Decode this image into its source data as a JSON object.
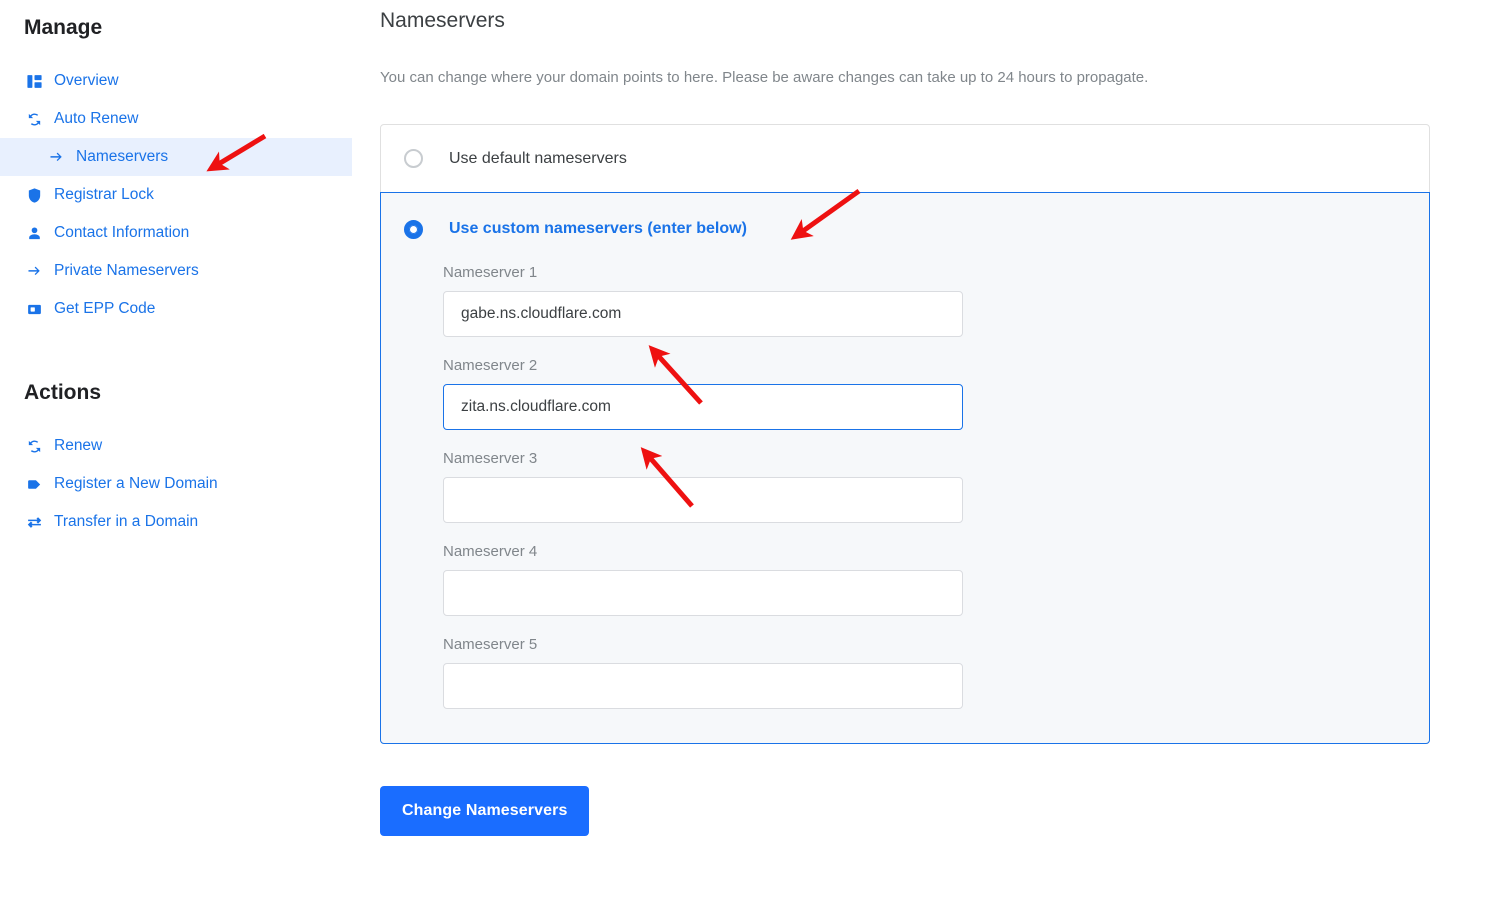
{
  "sidebar": {
    "manage_heading": "Manage",
    "manage_items": [
      {
        "label": "Overview",
        "icon": "dashboard-icon"
      },
      {
        "label": "Auto Renew",
        "icon": "refresh-icon"
      },
      {
        "label": "Nameservers",
        "icon": "arrow-forward-icon",
        "active": true
      },
      {
        "label": "Registrar Lock",
        "icon": "shield-icon"
      },
      {
        "label": "Contact Information",
        "icon": "person-icon"
      },
      {
        "label": "Private Nameservers",
        "icon": "arrow-forward-icon"
      },
      {
        "label": "Get EPP Code",
        "icon": "card-icon"
      }
    ],
    "actions_heading": "Actions",
    "action_items": [
      {
        "label": "Renew",
        "icon": "refresh-icon"
      },
      {
        "label": "Register a New Domain",
        "icon": "tag-icon"
      },
      {
        "label": "Transfer in a Domain",
        "icon": "swap-icon"
      }
    ]
  },
  "main": {
    "title": "Nameservers",
    "description": "You can change where your domain points to here. Please be aware changes can take up to 24 hours to propagate.",
    "options": {
      "default_label": "Use default nameservers",
      "custom_label": "Use custom nameservers (enter below)",
      "selected": "custom"
    },
    "nameserver_fields": [
      {
        "label": "Nameserver 1",
        "value": "gabe.ns.cloudflare.com",
        "placeholder": "",
        "focused": false
      },
      {
        "label": "Nameserver 2",
        "value": "zita.ns.cloudflare.com",
        "placeholder": "",
        "focused": true
      },
      {
        "label": "Nameserver 3",
        "value": "",
        "placeholder": "",
        "focused": false
      },
      {
        "label": "Nameserver 4",
        "value": "",
        "placeholder": "",
        "focused": false
      },
      {
        "label": "Nameserver 5",
        "value": "",
        "placeholder": "",
        "focused": false
      }
    ],
    "submit_label": "Change Nameservers"
  },
  "colors": {
    "link_blue": "#1a73e8",
    "button_blue": "#1a6dff",
    "active_row_bg": "#e8f0fe",
    "custom_block_bg": "#f6f8fa",
    "annotation_red": "#ee1111",
    "muted_text": "#80868b"
  }
}
